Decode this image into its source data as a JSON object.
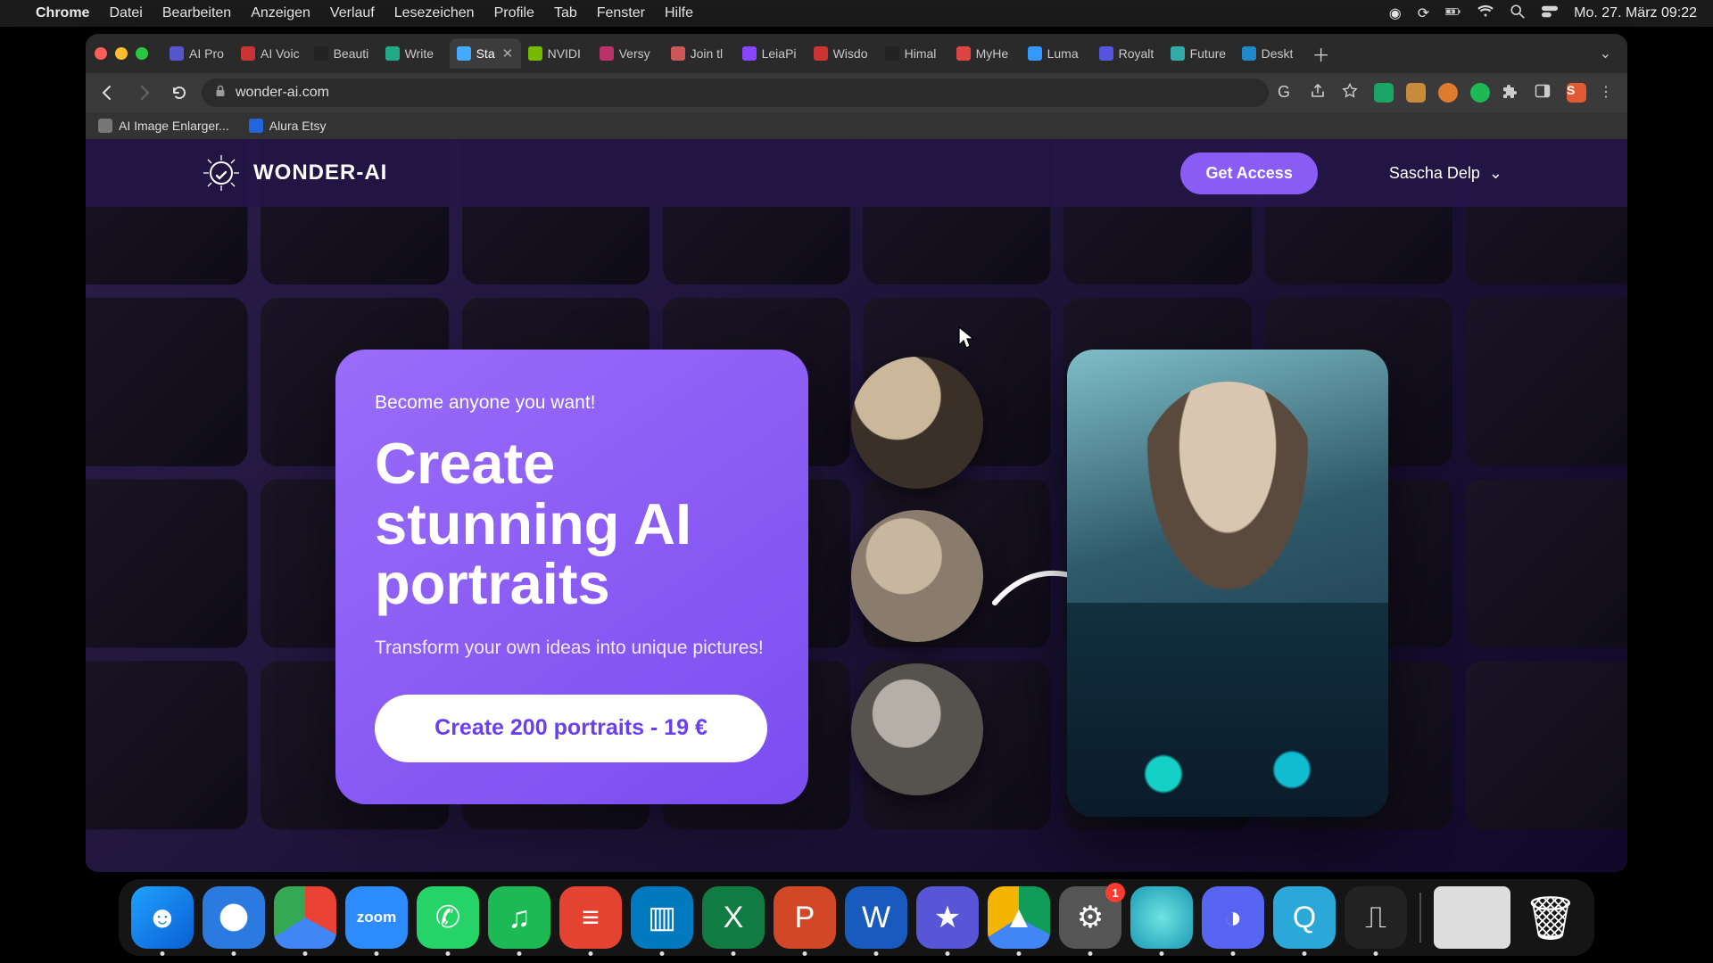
{
  "menubar": {
    "app": "Chrome",
    "items": [
      "Datei",
      "Bearbeiten",
      "Anzeigen",
      "Verlauf",
      "Lesezeichen",
      "Profile",
      "Tab",
      "Fenster",
      "Hilfe"
    ],
    "clock": "Mo. 27. März  09:22"
  },
  "chrome": {
    "tabs": [
      {
        "label": "AI Pro",
        "fav": "#55c"
      },
      {
        "label": "AI Voic",
        "fav": "#c33"
      },
      {
        "label": "Beauti",
        "fav": "#222"
      },
      {
        "label": "Write",
        "fav": "#2a8"
      },
      {
        "label": "Sta",
        "fav": "#4af",
        "active": true
      },
      {
        "label": "NVIDI",
        "fav": "#7b0"
      },
      {
        "label": "Versy",
        "fav": "#b36"
      },
      {
        "label": "Join tl",
        "fav": "#c55"
      },
      {
        "label": "LeiaPi",
        "fav": "#84f"
      },
      {
        "label": "Wisdo",
        "fav": "#c33"
      },
      {
        "label": "Himal",
        "fav": "#222"
      },
      {
        "label": "MyHe",
        "fav": "#d44"
      },
      {
        "label": "Luma",
        "fav": "#39f"
      },
      {
        "label": "Royalt",
        "fav": "#55d"
      },
      {
        "label": "Future",
        "fav": "#3aa"
      },
      {
        "label": "Deskt",
        "fav": "#28c"
      }
    ],
    "url": "wonder-ai.com",
    "bookmarks": [
      {
        "label": "AI Image Enlarger...",
        "ico": "#777"
      },
      {
        "label": "Alura Etsy",
        "ico": "#26d"
      }
    ],
    "profile_initial": "S"
  },
  "site": {
    "brand": "WONDER-AI",
    "get_access": "Get Access",
    "user": "Sascha Delp"
  },
  "hero": {
    "eyebrow": "Become anyone you want!",
    "title": "Create stunning AI portraits",
    "sub": "Transform your own ideas into unique pictures!",
    "cta": "Create 200 portraits - 19 €"
  },
  "dock": {
    "apps": [
      {
        "name": "finder",
        "bg": "linear-gradient(135deg,#1fa1ff,#0a5fd1)",
        "glyph": "☻"
      },
      {
        "name": "safari",
        "bg": "radial-gradient(circle,#fff 30%,#2a7adf 32%)",
        "glyph": "✦"
      },
      {
        "name": "chrome",
        "bg": "conic-gradient(#ea4335 0 33%,#4285f4 0 66%,#34a853 0)",
        "glyph": ""
      },
      {
        "name": "zoom",
        "bg": "#2d8cff",
        "glyph": "zoom",
        "text": true
      },
      {
        "name": "whatsapp",
        "bg": "#25d366",
        "glyph": "✆"
      },
      {
        "name": "spotify",
        "bg": "#1db954",
        "glyph": "♫"
      },
      {
        "name": "todoist",
        "bg": "#e44332",
        "glyph": "≡"
      },
      {
        "name": "trello",
        "bg": "#0079bf",
        "glyph": "▥"
      },
      {
        "name": "excel",
        "bg": "#107c41",
        "glyph": "X"
      },
      {
        "name": "powerpoint",
        "bg": "#d24726",
        "glyph": "P"
      },
      {
        "name": "word",
        "bg": "#185abd",
        "glyph": "W"
      },
      {
        "name": "imovie",
        "bg": "#5856d6",
        "glyph": "★"
      },
      {
        "name": "drive",
        "bg": "conic-gradient(#0f9d58 0 33%,#4285f4 0 66%,#f4b400 0)",
        "glyph": "▲"
      },
      {
        "name": "settings",
        "bg": "#555",
        "glyph": "⚙",
        "badge": "1"
      },
      {
        "name": "siri",
        "bg": "radial-gradient(circle,#6fe3e1,#1a9ab5)",
        "glyph": ""
      },
      {
        "name": "discord",
        "bg": "#5865f2",
        "glyph": "◑"
      },
      {
        "name": "quicktime",
        "bg": "#2aa8d8",
        "glyph": "Q"
      },
      {
        "name": "voice",
        "bg": "#222",
        "glyph": "⎍"
      }
    ],
    "right": [
      {
        "name": "desktop-preview",
        "bg": "#ddd",
        "glyph": ""
      },
      {
        "name": "trash",
        "bg": "transparent",
        "glyph": "🗑"
      }
    ]
  }
}
